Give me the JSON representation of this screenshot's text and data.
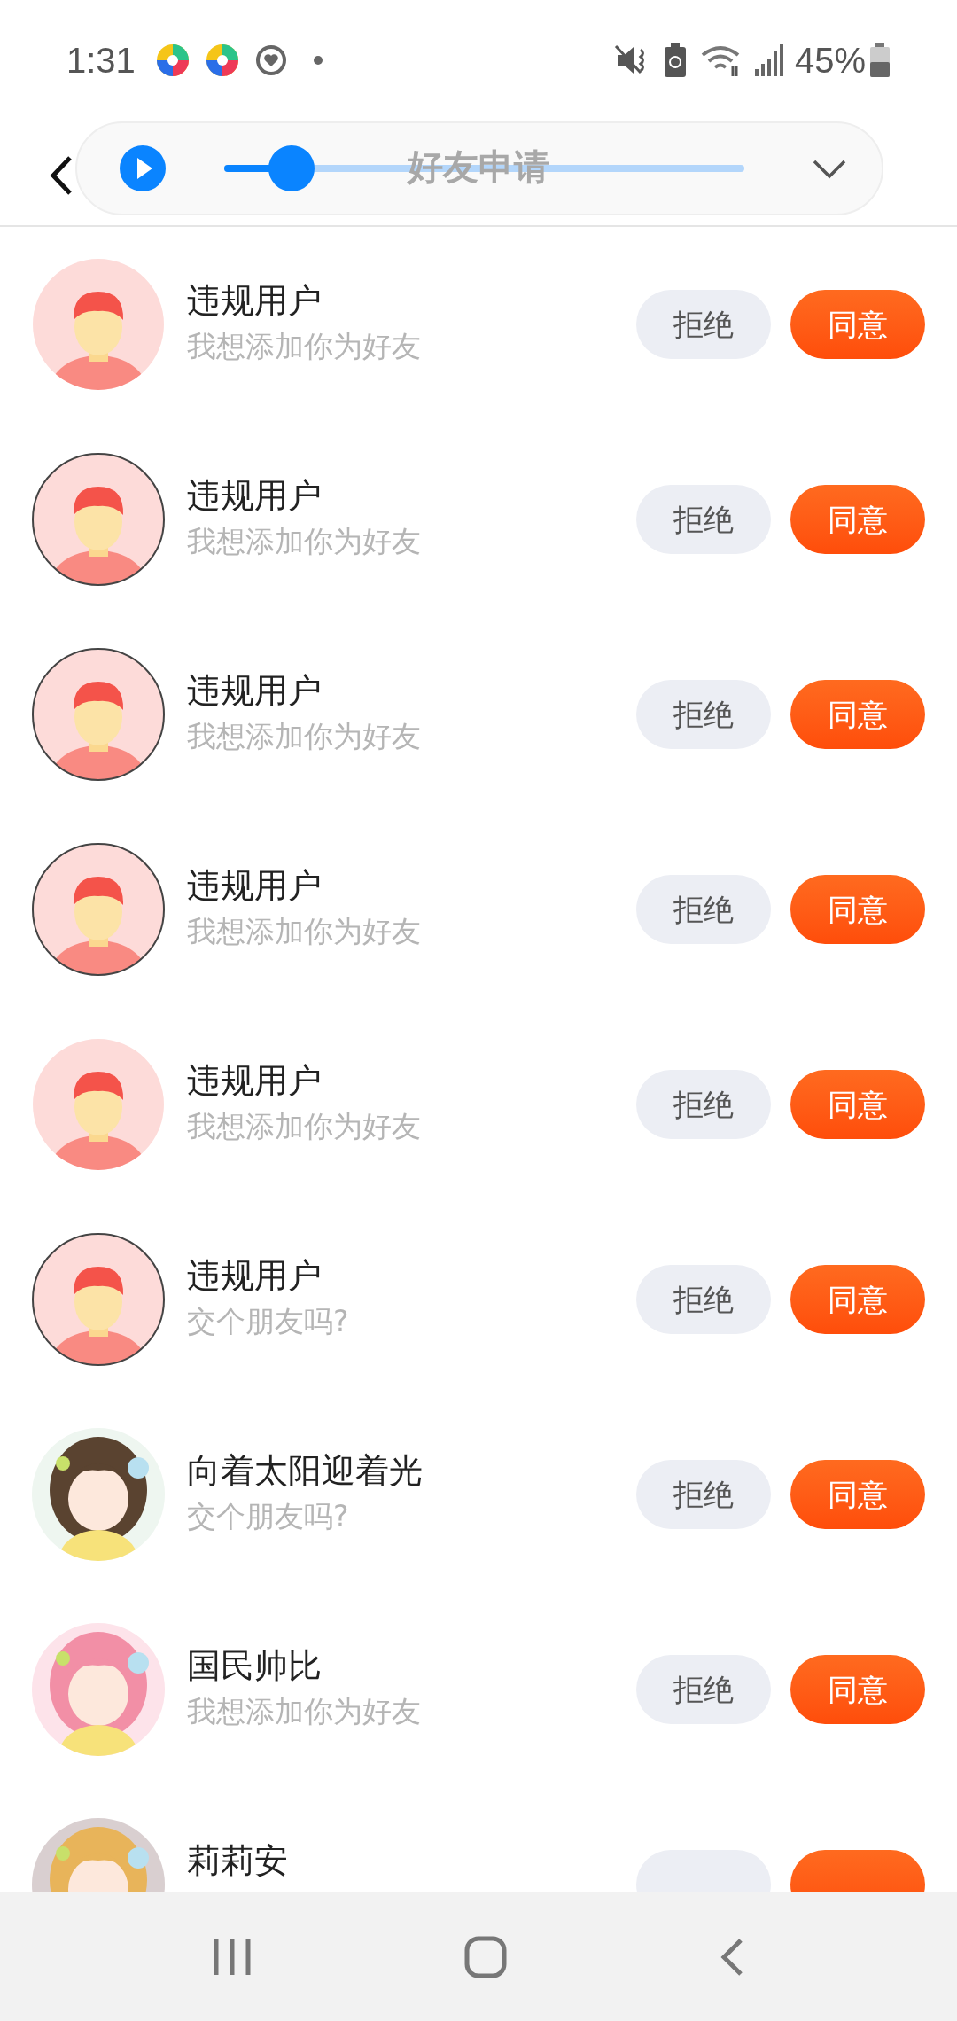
{
  "status_bar": {
    "time": "1:31",
    "battery": "45%"
  },
  "header": {
    "title": "好友申请"
  },
  "player": {
    "level": 0.13
  },
  "requests": [
    {
      "name": "违规用户",
      "message": "我想添加你为好友",
      "avatar": {
        "kind": "default",
        "outlined": false
      },
      "reject": "拒绝",
      "accept": "同意"
    },
    {
      "name": "违规用户",
      "message": "我想添加你为好友",
      "avatar": {
        "kind": "default",
        "outlined": true
      },
      "reject": "拒绝",
      "accept": "同意"
    },
    {
      "name": "违规用户",
      "message": "我想添加你为好友",
      "avatar": {
        "kind": "default",
        "outlined": true
      },
      "reject": "拒绝",
      "accept": "同意"
    },
    {
      "name": "违规用户",
      "message": "我想添加你为好友",
      "avatar": {
        "kind": "default",
        "outlined": true
      },
      "reject": "拒绝",
      "accept": "同意"
    },
    {
      "name": "违规用户",
      "message": "我想添加你为好友",
      "avatar": {
        "kind": "default",
        "outlined": false
      },
      "reject": "拒绝",
      "accept": "同意"
    },
    {
      "name": "违规用户",
      "message": "交个朋友吗?",
      "avatar": {
        "kind": "default",
        "outlined": true
      },
      "reject": "拒绝",
      "accept": "同意"
    },
    {
      "name": "向着太阳迎着光",
      "message": "交个朋友吗?",
      "reject": "拒绝",
      "accept": "同意"
    },
    {
      "name": "国民帅比",
      "message": "我想添加你为好友",
      "reject": "拒绝",
      "accept": "同意"
    },
    {
      "name": "莉莉安"
    }
  ]
}
